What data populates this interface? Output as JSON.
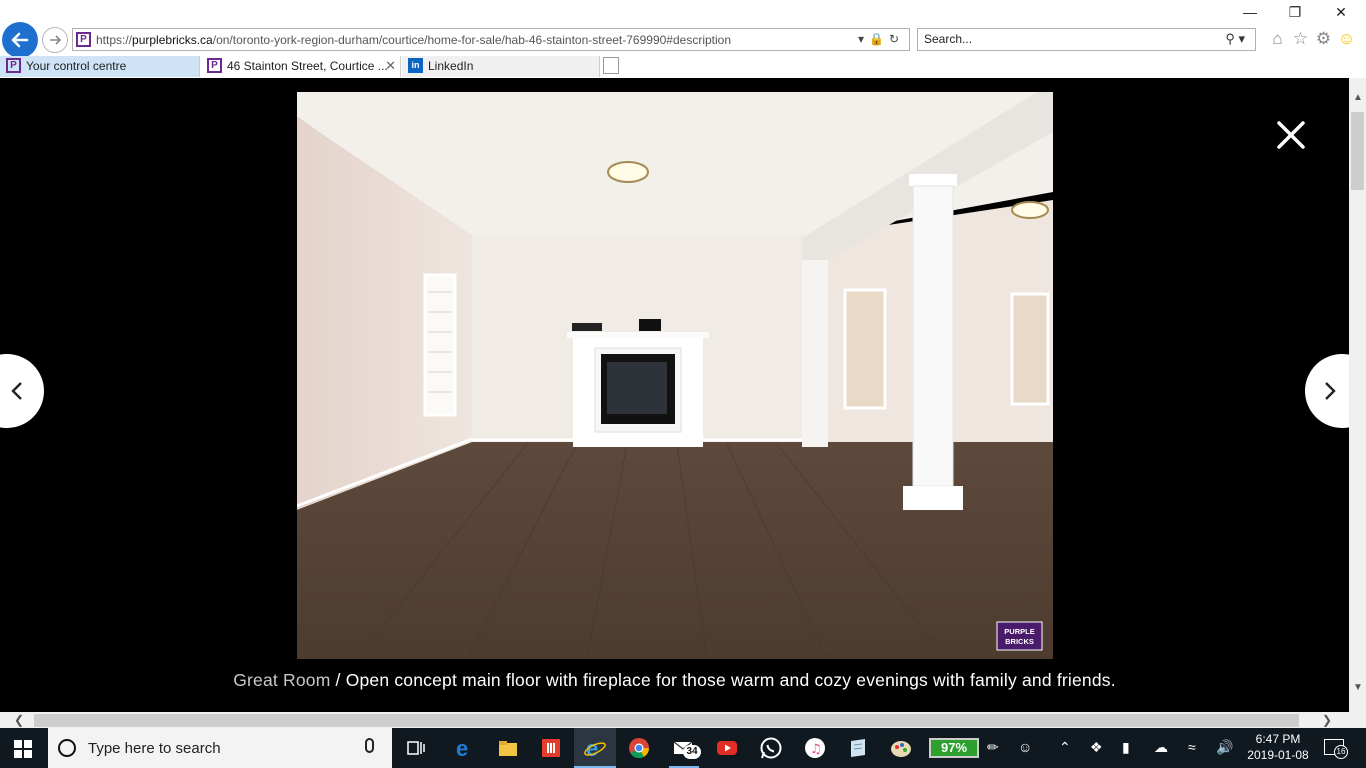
{
  "browser": {
    "address": {
      "protocol": "https://",
      "host": "purplebricks.ca",
      "path": "/on/toronto-york-region-durham/courtice/home-for-sale/hab-46-stainton-street-769990#description"
    },
    "search_placeholder": "Search...",
    "tabs": [
      {
        "label": "Your control centre",
        "favicon": "purplebricks-icon"
      },
      {
        "label": "46 Stainton Street, Courtice ...",
        "favicon": "purplebricks-icon",
        "active": true
      },
      {
        "label": "LinkedIn",
        "favicon": "linkedin-icon"
      }
    ],
    "favicon_letter": "P",
    "linkedin_letter": "in"
  },
  "lightbox": {
    "room": "Great Room",
    "separator": " / ",
    "description": "Open concept main floor with fireplace for those warm and cozy evenings with family and friends.",
    "watermark_line1": "PURPLE",
    "watermark_line2": "BRICKS"
  },
  "taskbar": {
    "search_placeholder": "Type here to search",
    "mail_badge": "34",
    "battery": "97%",
    "time": "6:47 PM",
    "date": "2019-01-08",
    "notifications": "16"
  },
  "colors": {
    "brand_purple": "#4a1a6b",
    "ie_blue": "#1e6fd0",
    "taskbar": "#101820",
    "battery_green": "#2ea02e"
  }
}
